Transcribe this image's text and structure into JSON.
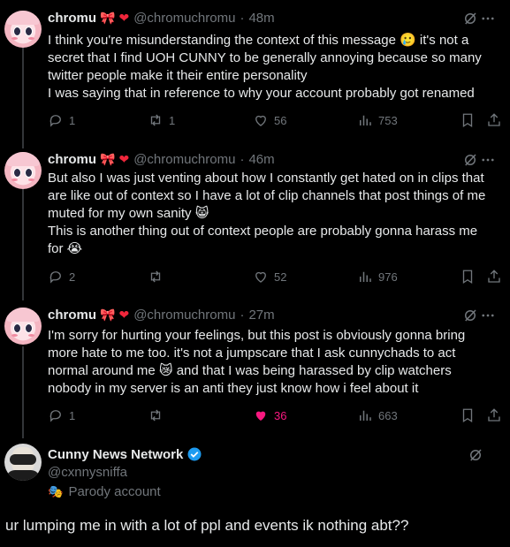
{
  "tweets": [
    {
      "name": "chromu",
      "emojis": [
        "🎀",
        "❤"
      ],
      "handle": "@chromuchromu",
      "time": "48m",
      "lines": [
        "I think you're misunderstanding the context of this message 🥲 it's not a",
        "secret that I find UOH CUNNY to be generally annoying because so many",
        "twitter people make it their entire personality",
        "I was saying that in reference to why your account probably got renamed"
      ],
      "replies": "1",
      "reposts": "1",
      "likes": "56",
      "views": "753"
    },
    {
      "name": "chromu",
      "emojis": [
        "🎀",
        "❤"
      ],
      "handle": "@chromuchromu",
      "time": "46m",
      "lines": [
        "But also I was just venting about how I constantly get hated on in clips that",
        "are like out of context so I have a lot of clip channels that post things of me",
        "muted for my own sanity 😸",
        "This is another thing out of context people are probably gonna harass me",
        "for 😭"
      ],
      "replies": "2",
      "reposts": "",
      "likes": "52",
      "views": "976"
    },
    {
      "name": "chromu",
      "emojis": [
        "🎀",
        "❤"
      ],
      "handle": "@chromuchromu",
      "time": "27m",
      "lines": [
        "I'm sorry for hurting your feelings, but this post is obviously gonna bring",
        "more hate to me too. it's not a jumpscare that I ask cunnychads to act",
        "normal around me 😿 and that I was being harassed by clip watchers",
        "nobody in my server is an anti they just know how i feel about it"
      ],
      "replies": "1",
      "reposts": "",
      "likes": "36",
      "views": "663"
    }
  ],
  "current": {
    "name": "Cunny News Network",
    "handle": "@cxnnysniffa",
    "parody_label": "Parody account",
    "parody_emoji": "🎭",
    "reply_text": "ur lumping me in with a lot of ppl and events ik nothing abt??"
  },
  "colors": {
    "background": "#000000",
    "text": "#e7e9ea",
    "muted": "#71767b",
    "like": "#f91880",
    "verified": "#1d9bf0"
  }
}
